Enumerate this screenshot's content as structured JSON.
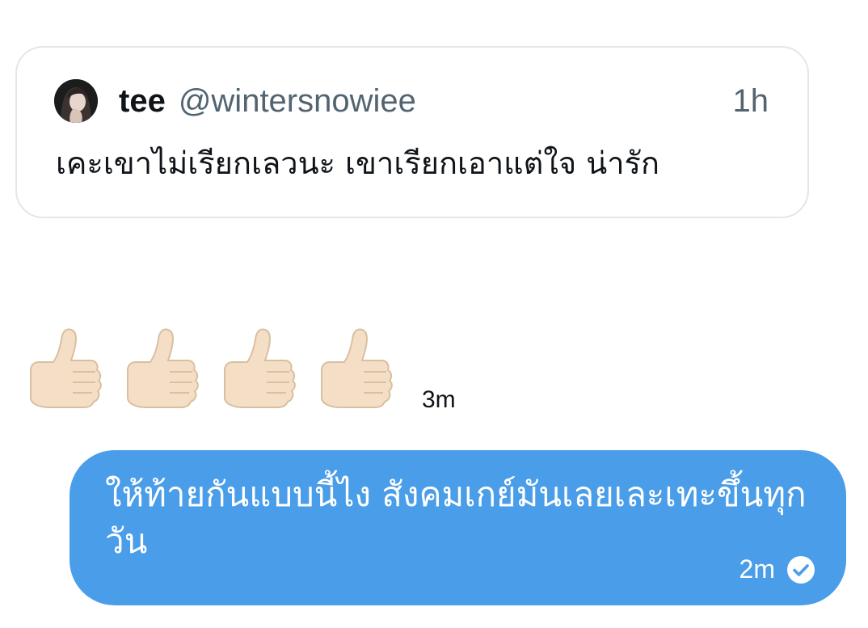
{
  "quoted_tweet": {
    "author_name": "tee",
    "author_handle": "@wintersnowiee",
    "time": "1h",
    "text": "เคะเขาไม่เรียกเลวนะ เขาเรียกเอาแต่ใจ น่ารัก",
    "avatar_icon": "profile-avatar"
  },
  "received_message": {
    "emoji": "👍🏻👍🏻👍🏻👍🏻",
    "emoji_icon": "thumbs-up-icon",
    "count": 4,
    "time": "3m"
  },
  "sent_message": {
    "text": "ให้ท้ายกันแบบนี้ไง สังคมเกย์มันเลยเละเทะขึ้นทุกวัน",
    "time": "2m",
    "status_icon": "read-check-icon",
    "bubble_color": "#4a9de8"
  },
  "colors": {
    "secondary_text": "#536471",
    "card_border": "#e3e6ea"
  }
}
